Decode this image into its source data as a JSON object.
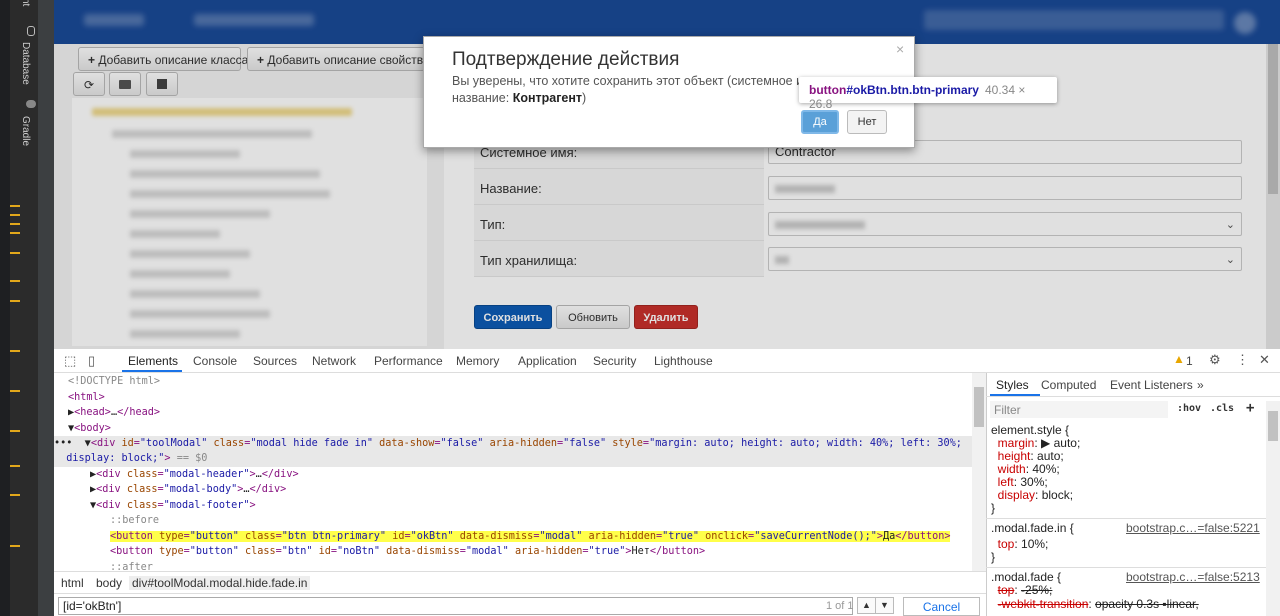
{
  "ide": {
    "tabs": [
      "Database",
      "Gradle"
    ],
    "partial_tab": "nt"
  },
  "toolbar": {
    "add_class_desc": "Добавить описание класса",
    "add_prop_desc": "Добавить описание свойства",
    "refresh_icon": "refresh-icon",
    "folder_icon": "folder-icon",
    "export_icon": "export-icon"
  },
  "form": {
    "rows": [
      {
        "label": "Системное имя:",
        "value": "Contractor"
      },
      {
        "label": "Название:",
        "value": ""
      },
      {
        "label": "Тип:",
        "value": ""
      },
      {
        "label": "Тип хранилища:",
        "value": ""
      }
    ],
    "save": "Сохранить",
    "update": "Обновить",
    "delete": "Удалить",
    "colors": {
      "primary": "#0d5cb6",
      "danger": "#c9302c"
    }
  },
  "modal": {
    "title": "Подтверждение действия",
    "body_prefix": "Вы уверены, что хотите сохранить этот объект (системное им",
    "body_line2_prefix": "название: ",
    "body_bold": "Контрагент",
    "body_suffix": ")",
    "close": "×",
    "ok": "Да",
    "no": "Нет"
  },
  "tooltip": {
    "tag": "button",
    "selector": "#okBtn.btn.btn-primary",
    "size": "40.34 × 26.8"
  },
  "devtools": {
    "tabs": [
      "Elements",
      "Console",
      "Sources",
      "Network",
      "Performance",
      "Memory",
      "Application",
      "Security",
      "Lighthouse"
    ],
    "active_tab": "Elements",
    "warnings": "1",
    "breadcrumbs": [
      "html",
      "body",
      "div#toolModal.modal.hide.fade.in"
    ],
    "search_value": "[id='okBtn']",
    "search_count": "1 of 1",
    "cancel": "Cancel"
  },
  "styles": {
    "tabs": [
      "Styles",
      "Computed",
      "Event Listeners"
    ],
    "more": "»",
    "filter_placeholder": "Filter",
    "hov": ":hov",
    "cls": ".cls",
    "plus": "+"
  }
}
